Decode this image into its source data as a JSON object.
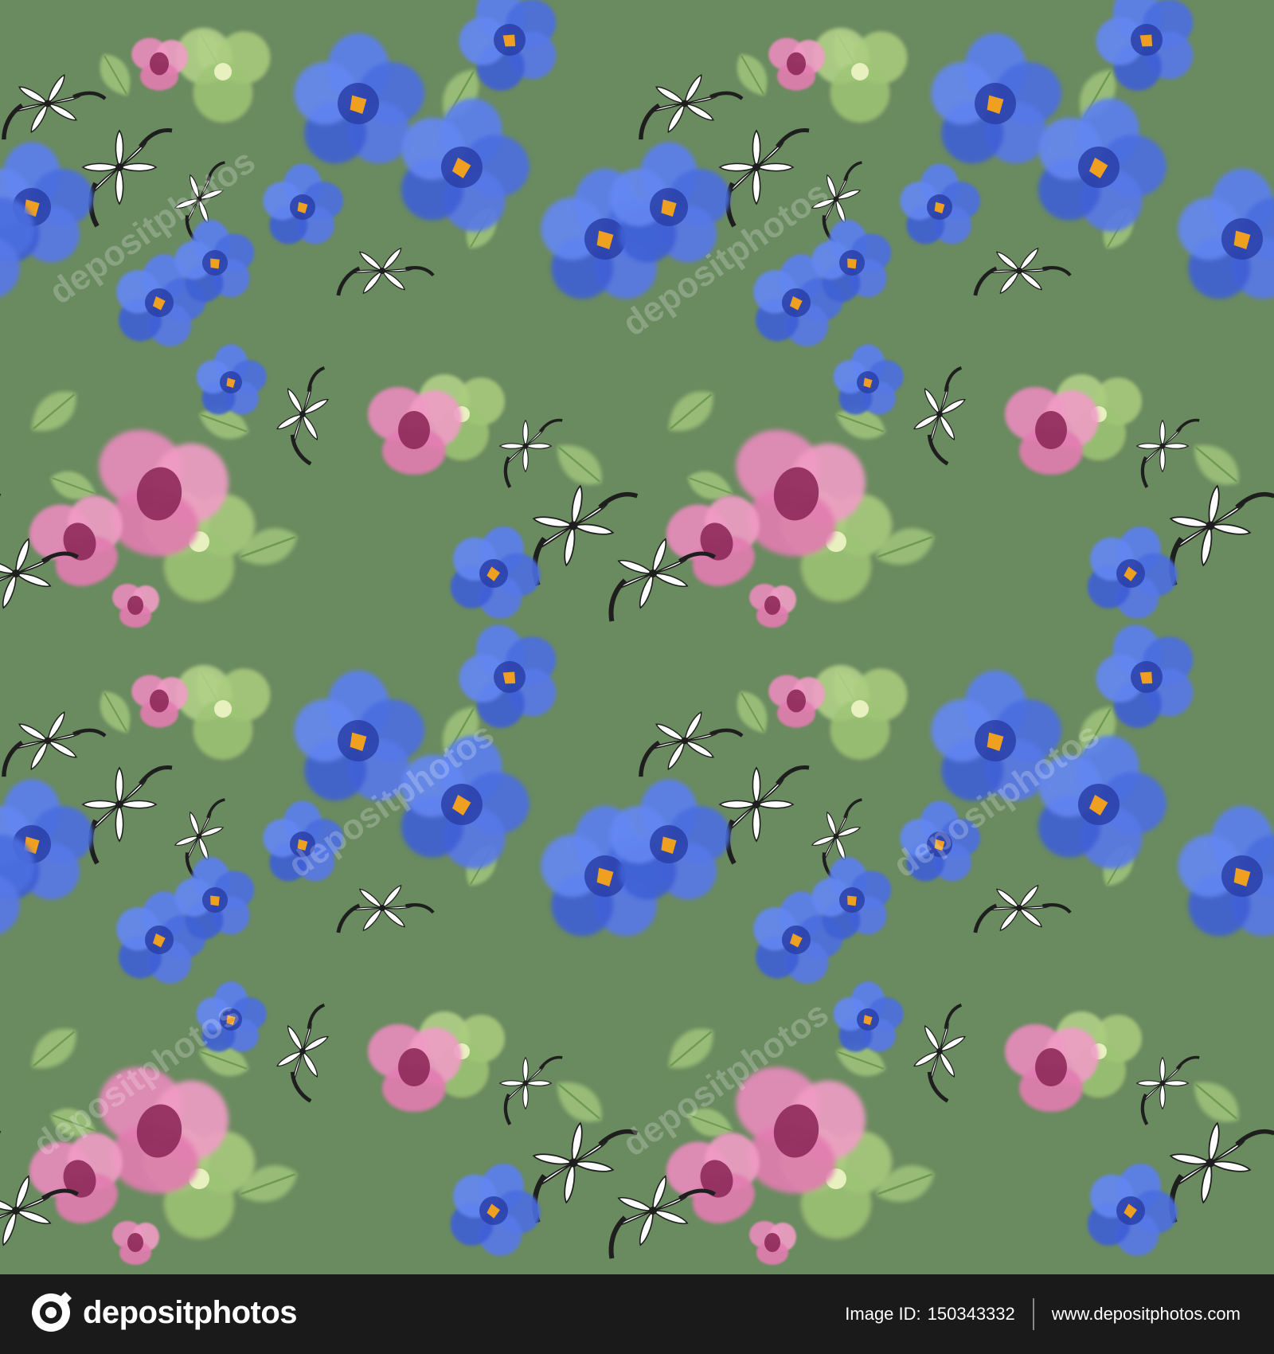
{
  "image": {
    "background_color": "#6a8a5f",
    "subject": "watercolor seamless floral pattern",
    "palette": {
      "blue_flower": "#4a6ee0",
      "blue_flower_dark": "#2a3fa8",
      "orange_center": "#f0a020",
      "pink_flower": "#e879b0",
      "pink_dark": "#8e2a5a",
      "leaf_green": "#9dc27a",
      "white_flower": "#ffffff",
      "ink": "#1e1e1e"
    }
  },
  "watermark": {
    "text": "depositphotos"
  },
  "footer": {
    "brand": "depositphotos",
    "image_id_label": "Image ID:",
    "image_id_value": "150343332",
    "site": "www.depositphotos.com"
  }
}
